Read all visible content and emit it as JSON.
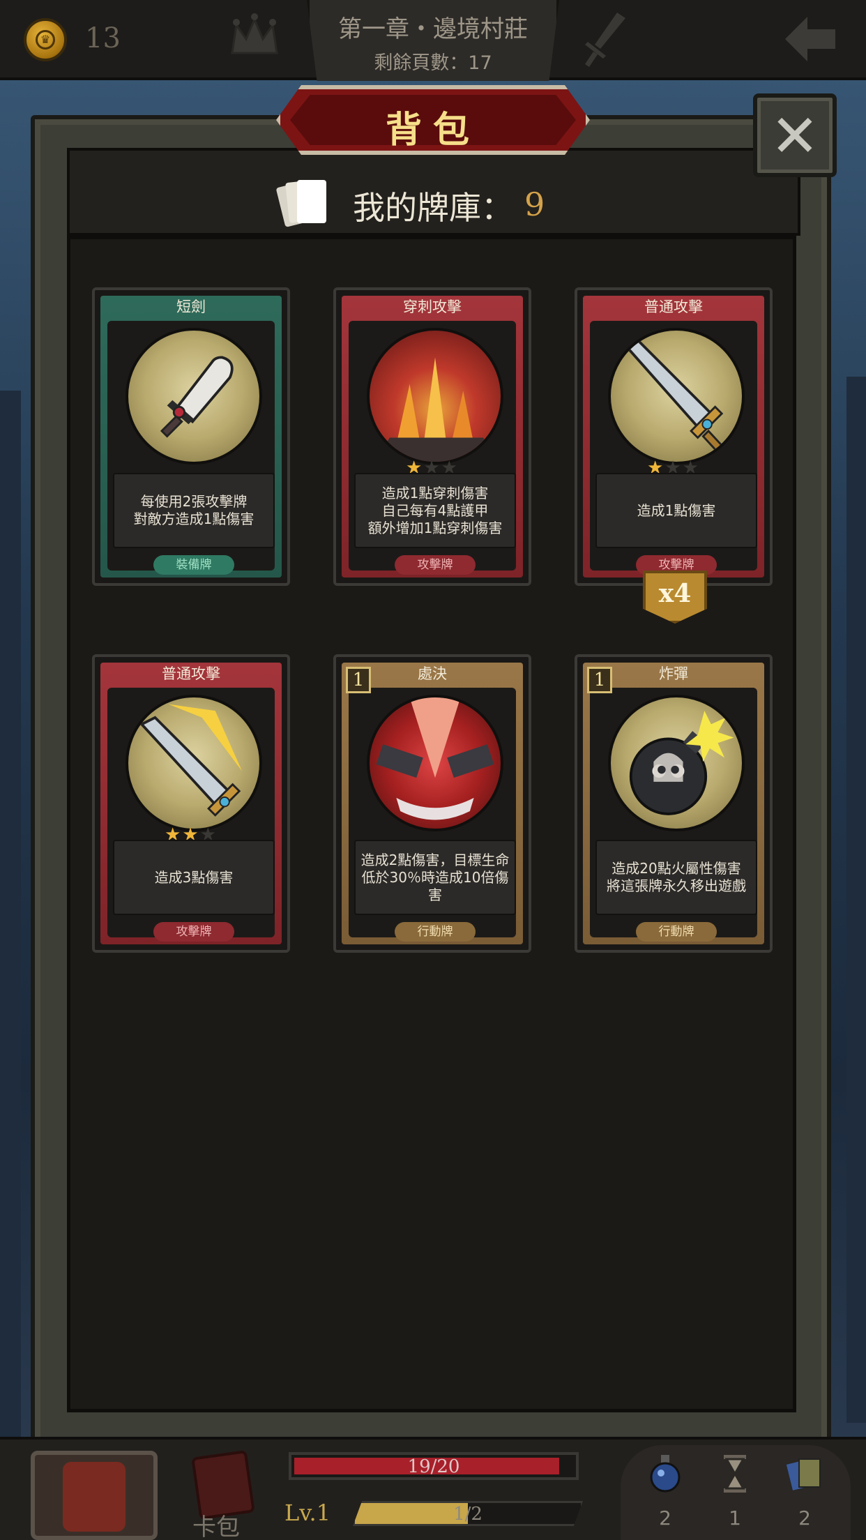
{
  "topbar": {
    "coins": "13",
    "chapter_title": "第一章・邊境村莊",
    "pages_left": "剩餘頁數：17"
  },
  "panel": {
    "title": "背包",
    "close_label": "✕",
    "deck_label": "我的牌庫：",
    "deck_count": "9"
  },
  "cards": [
    {
      "name": "短劍",
      "theme": "green",
      "stars": null,
      "cost": null,
      "description": "每使用2張攻擊牌\n對敵方造成1點傷害",
      "type": "裝備牌",
      "art": "dagger-icon",
      "count": null
    },
    {
      "name": "穿刺攻擊",
      "theme": "red",
      "stars": 1,
      "cost": null,
      "description": "造成1點穿刺傷害\n自己每有4點護甲\n額外增加1點穿刺傷害",
      "type": "攻擊牌",
      "art": "spikes-icon",
      "count": null
    },
    {
      "name": "普通攻擊",
      "theme": "red",
      "stars": 1,
      "cost": null,
      "description": "造成1點傷害",
      "type": "攻擊牌",
      "art": "sword-icon",
      "count": "x4"
    },
    {
      "name": "普通攻擊",
      "theme": "red",
      "stars": 2,
      "cost": null,
      "description": "造成3點傷害",
      "type": "攻擊牌",
      "art": "flaming-sword-icon",
      "count": null
    },
    {
      "name": "處決",
      "theme": "brown",
      "stars": null,
      "cost": "1",
      "description": "造成2點傷害，目標生命\n低於30％時造成10倍傷害",
      "type": "行動牌",
      "art": "execute-icon",
      "count": null
    },
    {
      "name": "炸彈",
      "theme": "brown",
      "stars": null,
      "cost": "1",
      "description": "造成20點火屬性傷害\n將這張牌永久移出遊戲",
      "type": "行動牌",
      "art": "bomb-icon",
      "count": null
    }
  ],
  "bottombar": {
    "cardpack_label": "卡包",
    "hp_text": "19/20",
    "hp_fraction": 0.95,
    "level_label": "Lv.1",
    "xp_text": "1/2",
    "xp_fraction": 0.5,
    "inventory": [
      {
        "icon": "potion-icon",
        "count": "2"
      },
      {
        "icon": "hourglass-icon",
        "count": "1"
      },
      {
        "icon": "cards-stack-icon",
        "count": "2"
      }
    ]
  },
  "colors": {
    "gold_accent": "#d4a24a",
    "banner_red": "#7d1414",
    "card_green": "#2e6a5a",
    "card_red": "#a3353b",
    "card_brown": "#9a7748",
    "hp_red": "#a8202a"
  }
}
